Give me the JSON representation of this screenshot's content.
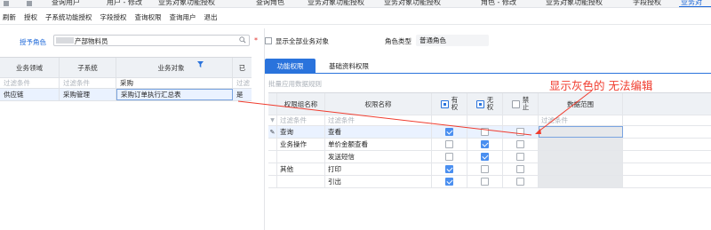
{
  "tabstrip": {
    "tabs": [
      {
        "label": "查询用户"
      },
      {
        "label": "用户 - 修改"
      },
      {
        "label": "业务对象功能授权"
      },
      {
        "label": "查询角色"
      },
      {
        "label": "业务对象功能授权"
      },
      {
        "label": "业务对象功能授权"
      },
      {
        "label": "角色 - 修改"
      },
      {
        "label": "业务对象功能授权"
      },
      {
        "label": "字段授权"
      },
      {
        "label": "业务对"
      }
    ]
  },
  "toolbar": {
    "items": [
      "刷新",
      "授权",
      "子系统功能授权",
      "字段授权",
      "查询权限",
      "查询用户",
      "退出"
    ]
  },
  "left": {
    "role_label": "授予角色",
    "role_value": "产部物料员",
    "columns": [
      "业务领域",
      "子系统",
      "业务对象",
      "已"
    ],
    "filter": [
      "过滤条件",
      "过滤条件",
      "采购",
      "过滤"
    ],
    "rows": [
      [
        "供应链",
        "采购管理",
        "采购订单执行汇总表",
        "是"
      ]
    ]
  },
  "right": {
    "show_all_label": "显示全部业务对象",
    "role_type_label": "角色类型",
    "role_type_value": "普通角色",
    "tabs": [
      "功能权限",
      "基础资料权限"
    ],
    "batch_text": "批量应用数据规则",
    "columns": {
      "group": "权限组名称",
      "name": "权限名称",
      "has": [
        "有",
        "权"
      ],
      "none": [
        "无",
        "权"
      ],
      "forbid": [
        "禁",
        "止"
      ],
      "scope": "数据范围"
    },
    "filter": [
      "过滤条件",
      "过滤条件",
      "过滤条件"
    ],
    "rows": [
      {
        "group": "查询",
        "name": "查看",
        "has": true,
        "none": false,
        "forbid": false,
        "selected": true
      },
      {
        "group": "业务操作",
        "name": "单价金额查看",
        "has": false,
        "none": true,
        "forbid": false
      },
      {
        "group": "",
        "name": "发送短信",
        "has": false,
        "none": true,
        "forbid": false
      },
      {
        "group": "其他",
        "name": "打印",
        "has": true,
        "none": false,
        "forbid": false
      },
      {
        "group": "",
        "name": "引出",
        "has": true,
        "none": false,
        "forbid": false
      }
    ]
  },
  "annotation": {
    "text": "显示灰色的  无法编辑",
    "color": "#f03c2e"
  },
  "colors": {
    "accent": "#2a73dc",
    "selected_row": "#eaf2ff",
    "check_fill": "#4a8ff0",
    "header_bg": "#eef1f5"
  }
}
